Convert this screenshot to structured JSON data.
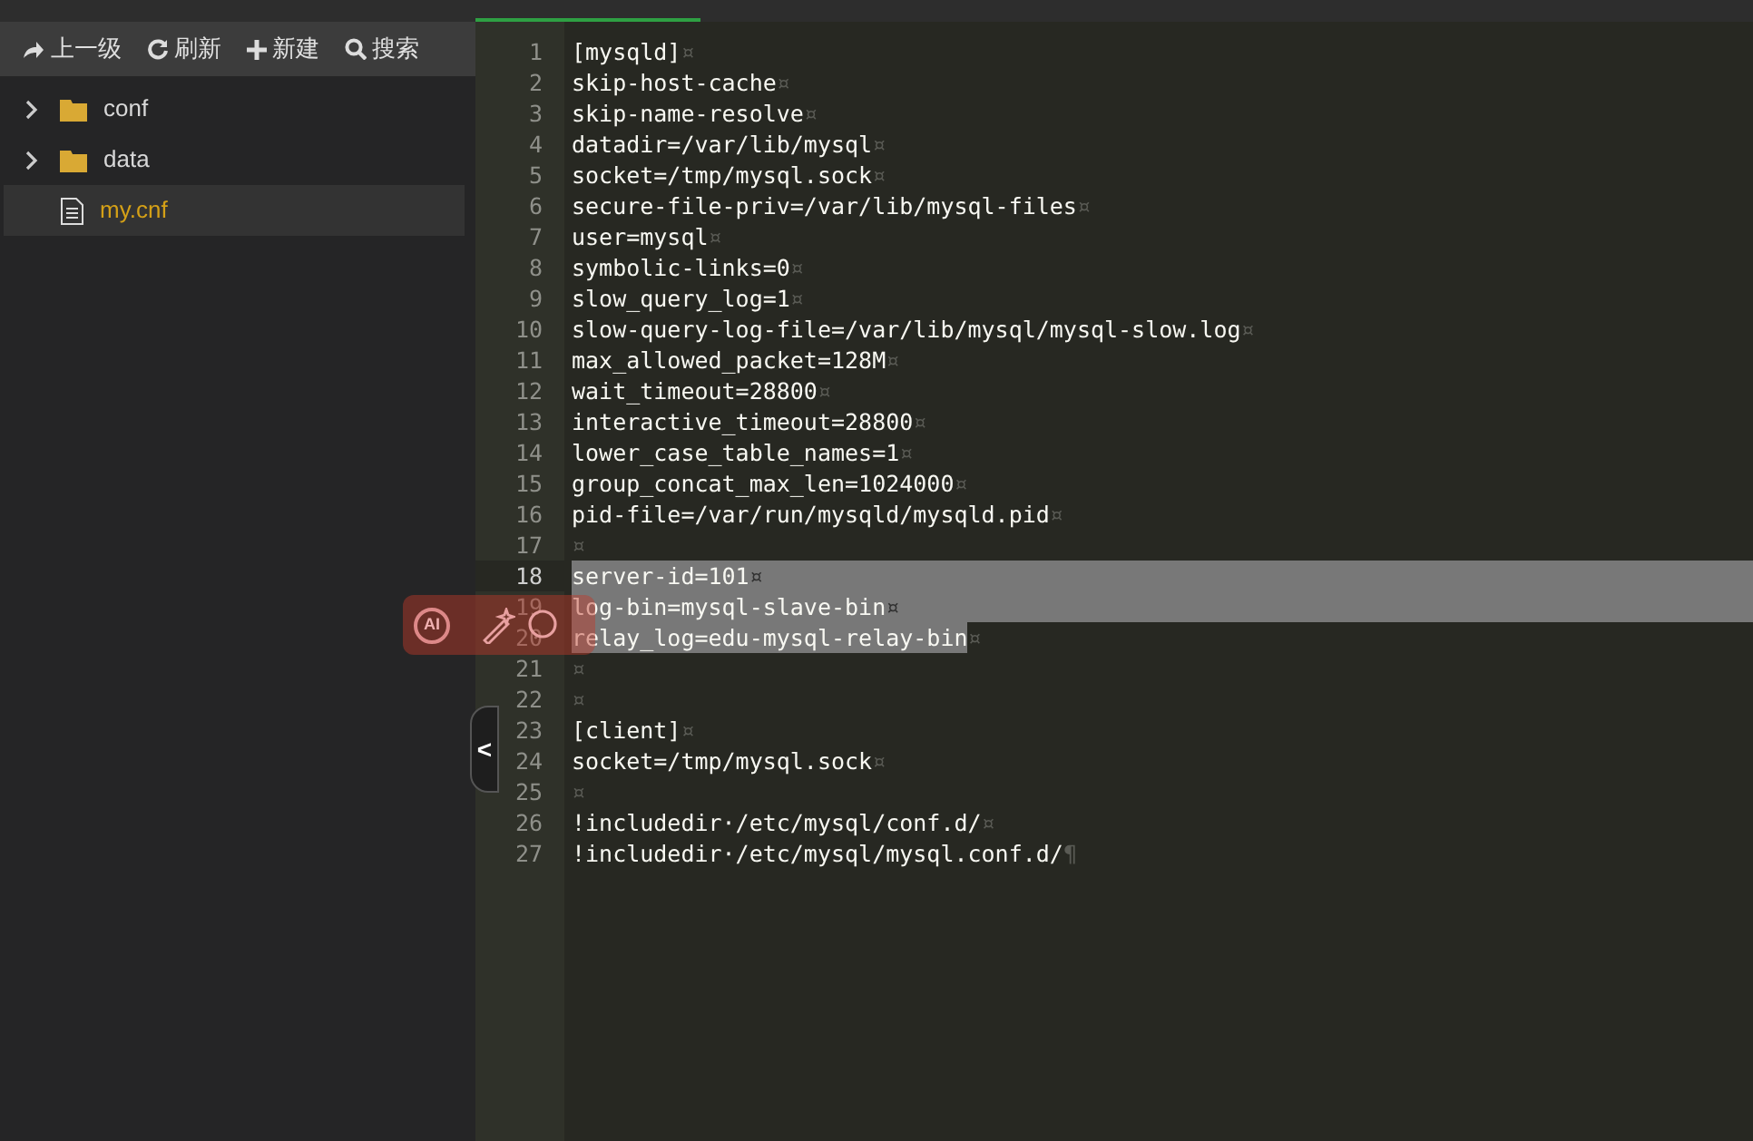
{
  "toolbar": [
    {
      "kind": "up",
      "label": "上一级"
    },
    {
      "kind": "refresh",
      "label": "刷新"
    },
    {
      "kind": "new",
      "label": "新建"
    },
    {
      "kind": "search",
      "label": "搜索"
    }
  ],
  "tree": [
    {
      "kind": "folder",
      "name": "conf",
      "selected": false
    },
    {
      "kind": "folder",
      "name": "data",
      "selected": false
    },
    {
      "kind": "file",
      "name": "my.cnf",
      "selected": true
    }
  ],
  "editor": {
    "lines": [
      {
        "number": "1",
        "text": "[mysqld]",
        "eol": "¤",
        "selected": false,
        "current": false
      },
      {
        "number": "2",
        "text": "skip-host-cache",
        "eol": "¤",
        "selected": false,
        "current": false
      },
      {
        "number": "3",
        "text": "skip-name-resolve",
        "eol": "¤",
        "selected": false,
        "current": false
      },
      {
        "number": "4",
        "text": "datadir=/var/lib/mysql",
        "eol": "¤",
        "selected": false,
        "current": false
      },
      {
        "number": "5",
        "text": "socket=/tmp/mysql.sock",
        "eol": "¤",
        "selected": false,
        "current": false
      },
      {
        "number": "6",
        "text": "secure-file-priv=/var/lib/mysql-files",
        "eol": "¤",
        "selected": false,
        "current": false
      },
      {
        "number": "7",
        "text": "user=mysql",
        "eol": "¤",
        "selected": false,
        "current": false
      },
      {
        "number": "8",
        "text": "symbolic-links=0",
        "eol": "¤",
        "selected": false,
        "current": false
      },
      {
        "number": "9",
        "text": "slow_query_log=1",
        "eol": "¤",
        "selected": false,
        "current": false
      },
      {
        "number": "10",
        "text": "slow-query-log-file=/var/lib/mysql/mysql-slow.log",
        "eol": "¤",
        "selected": false,
        "current": false
      },
      {
        "number": "11",
        "text": "max_allowed_packet=128M",
        "eol": "¤",
        "selected": false,
        "current": false
      },
      {
        "number": "12",
        "text": "wait_timeout=28800",
        "eol": "¤",
        "selected": false,
        "current": false
      },
      {
        "number": "13",
        "text": "interactive_timeout=28800",
        "eol": "¤",
        "selected": false,
        "current": false
      },
      {
        "number": "14",
        "text": "lower_case_table_names=1",
        "eol": "¤",
        "selected": false,
        "current": false
      },
      {
        "number": "15",
        "text": "group_concat_max_len=1024000",
        "eol": "¤",
        "selected": false,
        "current": false
      },
      {
        "number": "16",
        "text": "pid-file=/var/run/mysqld/mysqld.pid",
        "eol": "¤",
        "selected": false,
        "current": false
      },
      {
        "number": "17",
        "eol": "¤",
        "selected": false,
        "current": false
      },
      {
        "number": "18",
        "text": "server-id=101",
        "eol": "¤",
        "selected": true,
        "current": true
      },
      {
        "number": "19",
        "text": "log-bin=mysql-slave-bin",
        "eol": "¤",
        "selected": true,
        "current": false
      },
      {
        "number": "20",
        "text": "relay_log=edu-mysql-relay-bin",
        "eol": "¤",
        "selected": true,
        "current": false
      },
      {
        "number": "21",
        "eol": "¤",
        "selected": false,
        "current": false
      },
      {
        "number": "22",
        "eol": "¤",
        "selected": false,
        "current": false
      },
      {
        "number": "23",
        "text": "[client]",
        "eol": "¤",
        "selected": false,
        "current": false
      },
      {
        "number": "24",
        "text": "socket=/tmp/mysql.sock",
        "eol": "¤",
        "selected": false,
        "current": false
      },
      {
        "number": "25",
        "eol": "¤",
        "selected": false,
        "current": false
      },
      {
        "number": "26",
        "text": "!includedir·/etc/mysql/conf.d/",
        "eol": "¤",
        "selected": false,
        "current": false
      },
      {
        "number": "27",
        "text": "!includedir·/etc/mysql/mysql.conf.d/",
        "eol": "¶",
        "selected": false,
        "current": false
      }
    ]
  },
  "ai_toolbar": {
    "label": "AI"
  },
  "collapse_handle": {
    "label": "<"
  }
}
